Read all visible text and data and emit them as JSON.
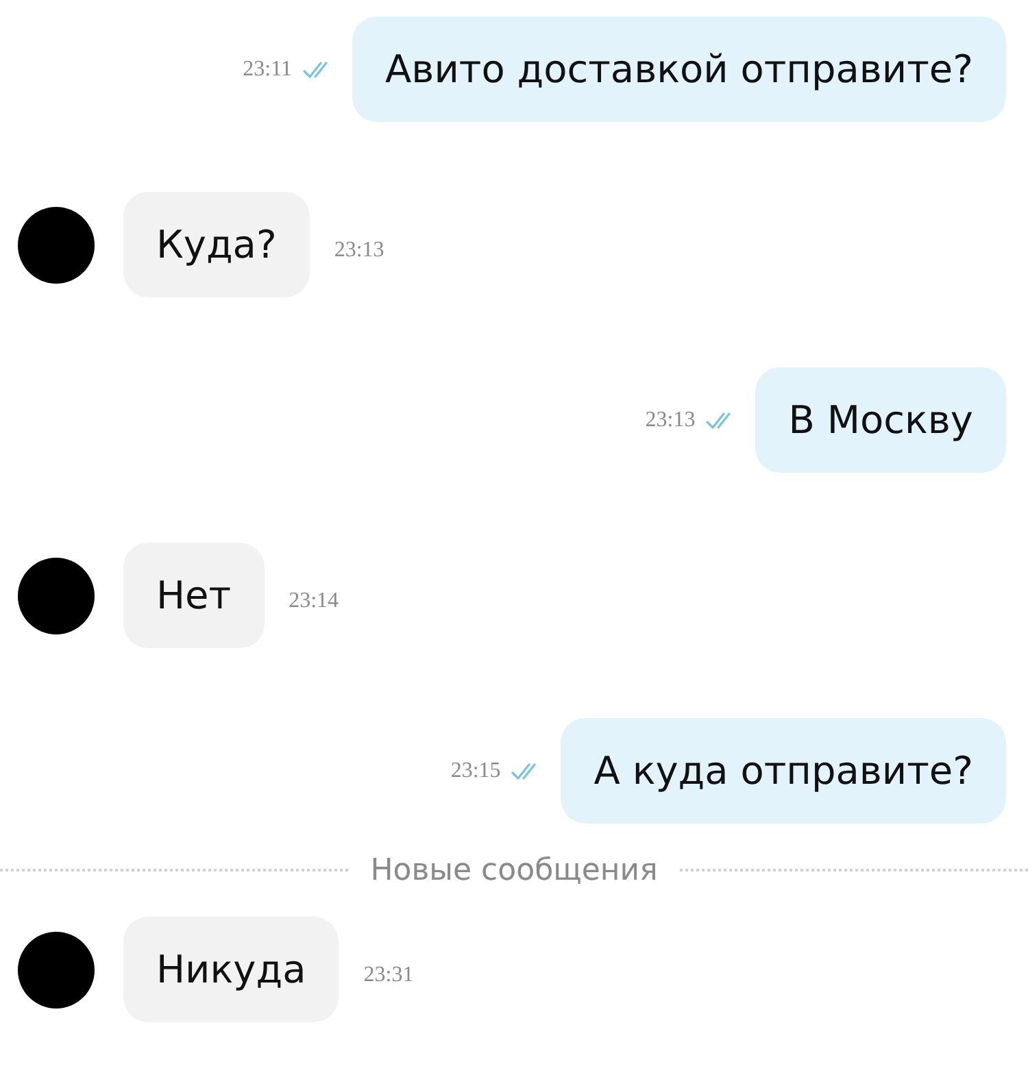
{
  "messages": [
    {
      "kind": "outgoing",
      "text": "Авито доставкой отправите?",
      "time": "23:11",
      "read": true
    },
    {
      "kind": "incoming",
      "text": "Куда?",
      "time": "23:13"
    },
    {
      "kind": "outgoing",
      "text": "В Москву",
      "time": "23:13",
      "read": true
    },
    {
      "kind": "incoming",
      "text": "Нет",
      "time": "23:14"
    },
    {
      "kind": "outgoing",
      "text": "А куда отправите?",
      "time": "23:15",
      "read": true
    },
    {
      "kind": "divider",
      "text": "Новые сообщения"
    },
    {
      "kind": "incoming",
      "text": "Никуда",
      "time": "23:31"
    }
  ]
}
